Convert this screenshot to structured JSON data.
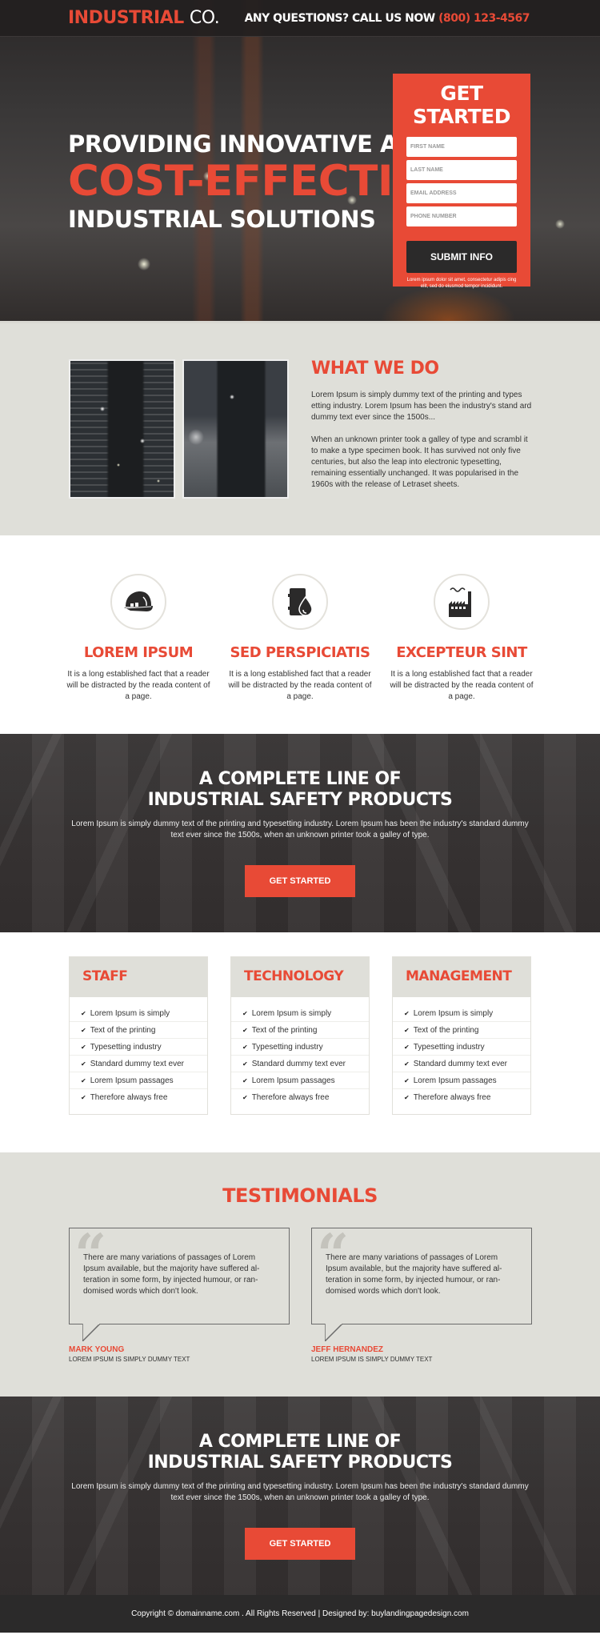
{
  "header": {
    "logo_accent": "INDUSTRIAL",
    "logo_plain": "CO.",
    "phone_prefix": "ANY QUESTIONS? CALL US NOW",
    "phone_number": "(800) 123-4567"
  },
  "hero": {
    "line1": "PROVIDING INNOVATIVE AND",
    "line2": "COST-EFFECTIVE",
    "line3": "INDUSTRIAL SOLUTIONS"
  },
  "form": {
    "title": "GET STARTED",
    "fields": [
      {
        "placeholder": "FIRST NAME",
        "value": ""
      },
      {
        "placeholder": "LAST NAME",
        "value": ""
      },
      {
        "placeholder": "EMAIL ADDRESS",
        "value": ""
      },
      {
        "placeholder": "PHONE NUMBER",
        "value": ""
      }
    ],
    "submit_label": "SUBMIT INFO",
    "note": "Lorem ipsum dolor sit amet, consectetur adipis cing elit, sed do eiusmod tempor incididunt."
  },
  "what_we_do": {
    "title": "WHAT WE DO",
    "para1": "Lorem Ipsum is simply dummy text of the printing and types etting industry. Lorem Ipsum has been the industry's stand ard dummy text ever since the 1500s...",
    "para2": "When an unknown printer took a galley of type and scrambl it to make a type specimen book. It has survived not only five centuries, but also the leap into electronic typesetting, remaining essentially unchanged. It was popularised in the 1960s with the release of Letraset sheets."
  },
  "features": [
    {
      "icon": "hard-hat-icon",
      "title": "LOREM IPSUM",
      "desc": "It is a long established fact that a reader will be distracted by the reada content of a page."
    },
    {
      "icon": "oil-barrel-icon",
      "title": "SED PERSPICIATIS",
      "desc": "It is a long established fact that a reader will be distracted by the reada content of a page."
    },
    {
      "icon": "factory-icon",
      "title": "EXCEPTEUR SINT",
      "desc": "It is a long established fact that a reader will be distracted by the reada content of a page."
    }
  ],
  "cta1": {
    "title_line1": "A COMPLETE LINE OF",
    "title_line2": "INDUSTRIAL SAFETY PRODUCTS",
    "text": "Lorem Ipsum is simply dummy text of the printing and typesetting industry. Lorem Ipsum has been the industry's standard dummy text ever since the 1500s, when an unknown printer took a galley of type.",
    "button": "GET STARTED"
  },
  "plans": [
    {
      "title": "STAFF",
      "items": [
        "Lorem Ipsum is simply",
        "Text of the printing",
        "Typesetting industry",
        "Standard dummy text ever",
        "Lorem Ipsum passages",
        "Therefore always free"
      ]
    },
    {
      "title": "TECHNOLOGY",
      "items": [
        "Lorem Ipsum is simply",
        "Text of the printing",
        "Typesetting industry",
        "Standard dummy text ever",
        "Lorem Ipsum passages",
        "Therefore always free"
      ]
    },
    {
      "title": "MANAGEMENT",
      "items": [
        "Lorem Ipsum is simply",
        "Text of the printing",
        "Typesetting industry",
        "Standard dummy text ever",
        "Lorem Ipsum passages",
        "Therefore always free"
      ]
    }
  ],
  "testimonials": {
    "title": "TESTIMONIALS",
    "quote_mark": "“",
    "items": [
      {
        "text": "There are many variations of passages of Lorem Ipsum available, but the majority have suffered al- teration in some form, by injected humour, or ran- domised words which don't look.",
        "name": "MARK YOUNG",
        "role": "LOREM IPSUM IS SIMPLY DUMMY TEXT"
      },
      {
        "text": "There are many variations of passages of Lorem Ipsum available, but the majority have suffered al- teration in some form, by injected humour, or ran- domised words which don't look.",
        "name": "JEFF HERNANDEZ",
        "role": "LOREM IPSUM IS SIMPLY DUMMY TEXT"
      }
    ]
  },
  "cta2": {
    "title_line1": "A COMPLETE LINE OF",
    "title_line2": "INDUSTRIAL SAFETY PRODUCTS",
    "text": "Lorem Ipsum is simply dummy text of the printing and typesetting industry. Lorem Ipsum has been the industry's standard dummy text ever since the 1500s, when an unknown printer took a galley of type.",
    "button": "GET STARTED"
  },
  "footer": {
    "text": "Copyright © domainname.com . All Rights Reserved | Designed by: buylandingpagedesign.com"
  },
  "colors": {
    "accent": "#e84a36",
    "dark": "#2b2a2a",
    "light_bg": "#dfdfd9"
  }
}
